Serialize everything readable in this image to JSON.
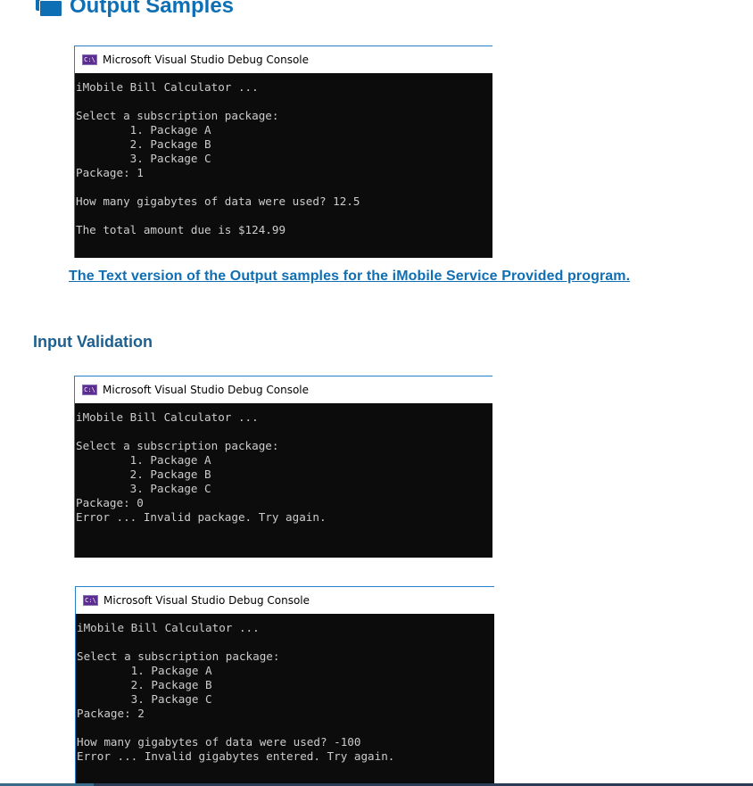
{
  "sections": {
    "output_samples": {
      "title": "Output Samples",
      "icon": "folder-windows-icon",
      "link_text": "The Text version of the Output samples for the iMobile Service Provided program."
    },
    "input_validation": {
      "title": "Input Validation"
    }
  },
  "console_window_title": "Microsoft Visual Studio Debug Console",
  "console_icon_text": "C:\\",
  "consoles": [
    {
      "lines": [
        "iMobile Bill Calculator ...",
        "",
        "Select a subscription package:",
        "        1. Package A",
        "        2. Package B",
        "        3. Package C",
        "Package: 1",
        "",
        "How many gigabytes of data were used? 12.5",
        "",
        "The total amount due is $124.99"
      ]
    },
    {
      "lines": [
        "iMobile Bill Calculator ...",
        "",
        "Select a subscription package:",
        "        1. Package A",
        "        2. Package B",
        "        3. Package C",
        "Package: 0",
        "Error ... Invalid package. Try again."
      ]
    },
    {
      "lines": [
        "iMobile Bill Calculator ...",
        "",
        "Select a subscription package:",
        "        1. Package A",
        "        2. Package B",
        "        3. Package C",
        "Package: 2",
        "",
        "How many gigabytes of data were used? -100",
        "Error ... Invalid gigabytes entered. Try again."
      ]
    }
  ],
  "colors": {
    "heading": "#0f6fb5",
    "subheading": "#1d5f8f",
    "console_bg": "#0c0c0c",
    "console_text": "#cccccc",
    "window_border": "#2a7fc9",
    "console_icon": "#5c2d91"
  }
}
